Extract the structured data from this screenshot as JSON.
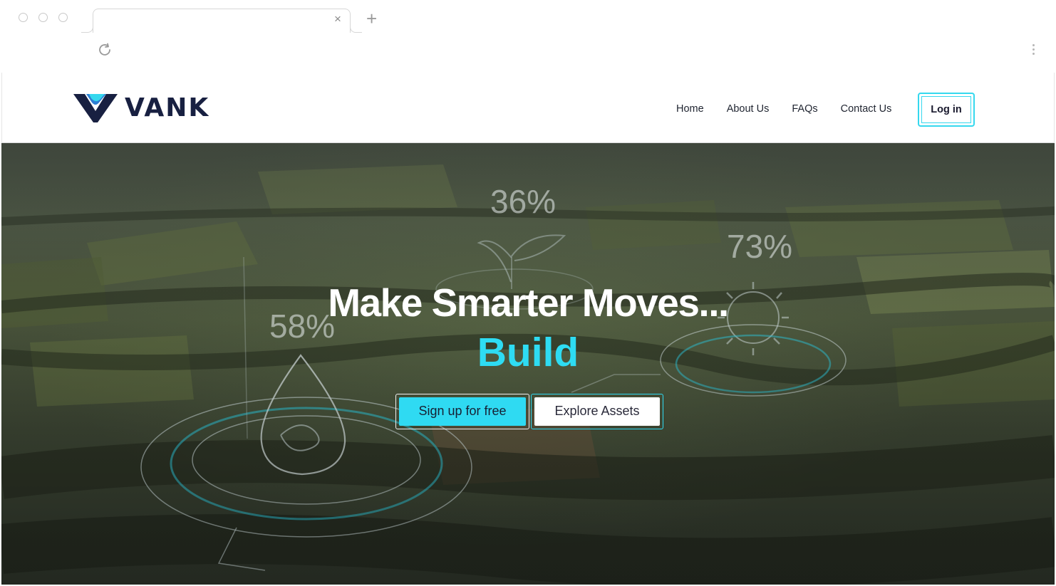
{
  "browser": {
    "tab_close_glyph": "×",
    "new_tab_glyph": "+",
    "icons": [
      "reload-icon",
      "kebab-menu-icon"
    ]
  },
  "header": {
    "logo_text": "VANK",
    "nav": [
      {
        "label": "Home"
      },
      {
        "label": "About Us"
      },
      {
        "label": "FAQs"
      },
      {
        "label": "Contact Us"
      }
    ],
    "login_label": "Log in"
  },
  "hero": {
    "headline": "Make Smarter Moves...",
    "accent_word": "Build",
    "stats": [
      "36%",
      "73%",
      "58%"
    ],
    "primary_cta": "Sign up for free",
    "secondary_cta": "Explore Assets"
  },
  "colors": {
    "brand_navy": "#182041",
    "accent_cyan": "#2edcf3"
  }
}
